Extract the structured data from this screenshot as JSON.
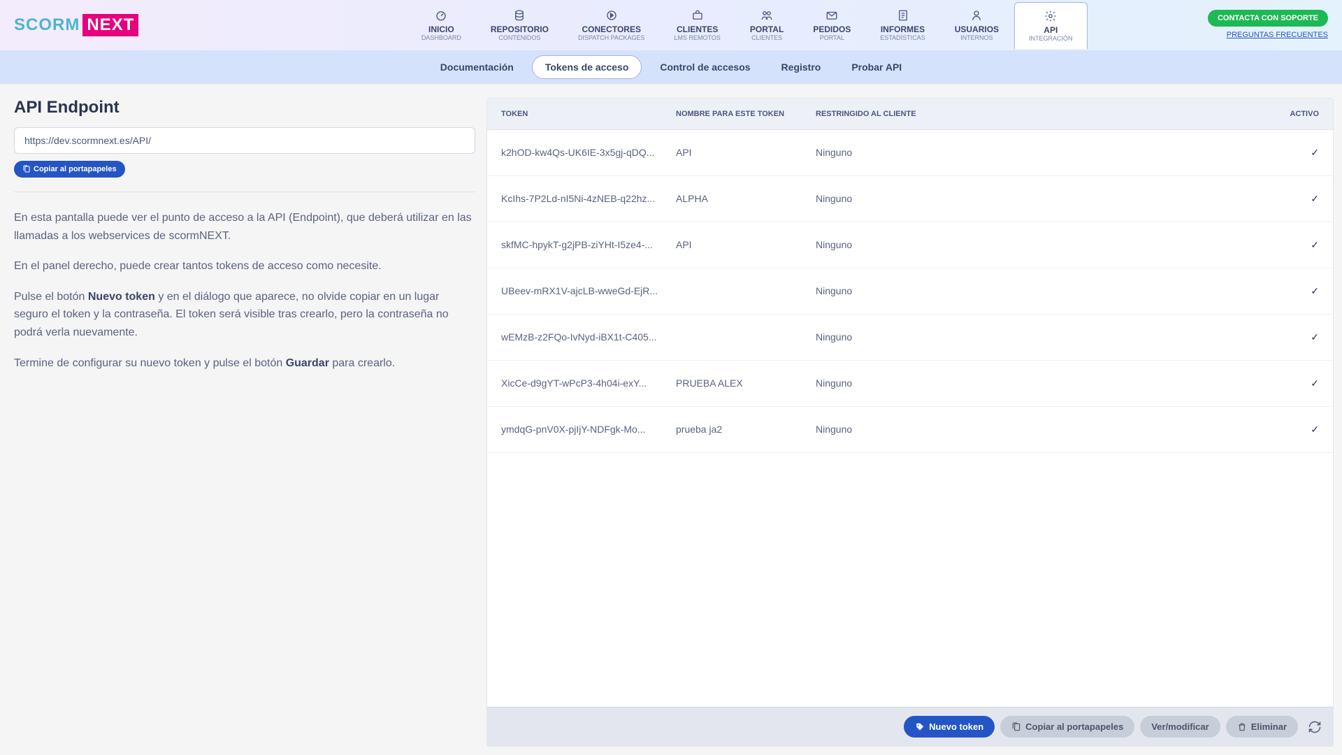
{
  "logo": {
    "a": "SCORM",
    "b": "NEXT"
  },
  "nav": [
    {
      "label": "INICIO",
      "sub": "DASHBOARD",
      "icon": "dashboard"
    },
    {
      "label": "REPOSITORIO",
      "sub": "CONTENIDOS",
      "icon": "repo"
    },
    {
      "label": "CONECTORES",
      "sub": "DISPATCH PACKAGES",
      "icon": "connectors"
    },
    {
      "label": "CLIENTES",
      "sub": "LMS REMOTOS",
      "icon": "clients"
    },
    {
      "label": "PORTAL",
      "sub": "CLIENTES",
      "icon": "portal"
    },
    {
      "label": "PEDIDOS",
      "sub": "PORTAL",
      "icon": "orders"
    },
    {
      "label": "INFORMES",
      "sub": "ESTADÍSTICAS",
      "icon": "reports"
    },
    {
      "label": "USUARIOS",
      "sub": "INTERNOS",
      "icon": "users"
    },
    {
      "label": "API",
      "sub": "INTEGRACIÓN",
      "icon": "api",
      "active": true
    }
  ],
  "header_right": {
    "contact": "CONTACTA CON SOPORTE",
    "faq": "PREGUNTAS FRECUENTES"
  },
  "tabs": [
    {
      "label": "Documentación"
    },
    {
      "label": "Tokens de acceso",
      "active": true
    },
    {
      "label": "Control de accesos"
    },
    {
      "label": "Registro"
    },
    {
      "label": "Probar API"
    }
  ],
  "left": {
    "title": "API Endpoint",
    "endpoint": "https://dev.scormnext.es/API/",
    "copy": "Copiar al portapapeles",
    "p1": "En esta pantalla puede ver el punto de acceso a la API (Endpoint), que deberá utilizar en las llamadas a los webservices de scormNEXT.",
    "p2": "En el panel derecho, puede crear tantos tokens de acceso como necesite.",
    "p3a": "Pulse el botón ",
    "p3b": "Nuevo token",
    "p3c": " y en el diálogo que aparece, no olvide copiar en un lugar seguro el token y la contraseña. El token será visible tras crearlo, pero la contraseña no podrá verla nuevamente.",
    "p4a": "Termine de configurar su nuevo token y pulse el botón ",
    "p4b": "Guardar",
    "p4c": " para crearlo."
  },
  "table": {
    "headers": {
      "token": "TOKEN",
      "name": "NOMBRE PARA ESTE TOKEN",
      "client": "RESTRINGIDO AL CLIENTE",
      "active": "ACTIVO"
    },
    "rows": [
      {
        "token": "k2hOD-kw4Qs-UK6IE-3x5gj-qDQ...",
        "name": "API",
        "client": "Ninguno",
        "active": "✓"
      },
      {
        "token": "KcIhs-7P2Ld-nI5Ni-4zNEB-q22hz...",
        "name": "ALPHA",
        "client": "Ninguno",
        "active": "✓"
      },
      {
        "token": "skfMC-hpykT-g2jPB-ziYHt-I5ze4-...",
        "name": "API",
        "client": "Ninguno",
        "active": "✓"
      },
      {
        "token": "UBeev-mRX1V-ajcLB-wweGd-EjR...",
        "name": "",
        "client": "Ninguno",
        "active": "✓"
      },
      {
        "token": "wEMzB-z2FQo-IvNyd-iBX1t-C405...",
        "name": "",
        "client": "Ninguno",
        "active": "✓"
      },
      {
        "token": "XicCe-d9gYT-wPcP3-4h04i-exY...",
        "name": "PRUEBA ALEX",
        "client": "Ninguno",
        "active": "✓"
      },
      {
        "token": "ymdqG-pnV0X-pjIjY-NDFgk-Mo...",
        "name": "prueba ja2",
        "client": "Ninguno",
        "active": "✓"
      }
    ]
  },
  "footer": {
    "new": "Nuevo token",
    "copy": "Copiar al portapapeles",
    "view": "Ver/modificar",
    "delete": "Eliminar"
  }
}
